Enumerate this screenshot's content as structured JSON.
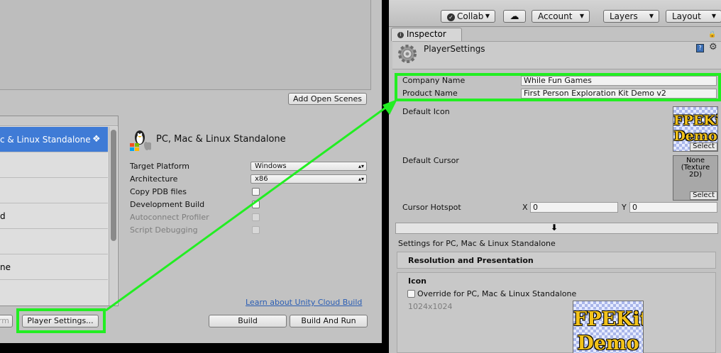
{
  "build_window": {
    "add_open_scenes": "Add Open Scenes",
    "platform_list": [
      "c & Linux Standalone",
      "",
      "",
      "d",
      "",
      "ne",
      ""
    ],
    "platform_title": "PC, Mac & Linux Standalone",
    "settings": {
      "target_platform_label": "Target Platform",
      "target_platform_value": "Windows",
      "architecture_label": "Architecture",
      "architecture_value": "x86",
      "copy_pdb_label": "Copy PDB files",
      "development_build_label": "Development Build",
      "autoconnect_label": "Autoconnect Profiler",
      "script_debugging_label": "Script Debugging"
    },
    "learn_link": "Learn about Unity Cloud Build",
    "switch_platform_partial": "rm",
    "player_settings_button": "Player Settings...",
    "build_button": "Build",
    "build_and_run_button": "Build And Run"
  },
  "toolbar": {
    "collab": "Collab",
    "account": "Account",
    "layers": "Layers",
    "layout": "Layout"
  },
  "inspector": {
    "tab_label": "Inspector",
    "object_title": "PlayerSettings",
    "company_name_label": "Company Name",
    "company_name_value": "While Fun Games",
    "product_name_label": "Product Name",
    "product_name_value": "First Person Exploration Kit Demo v2",
    "default_icon_label": "Default Icon",
    "icon_logo_line1": "FPEKit",
    "icon_logo_line2": "Demo",
    "select_label": "Select",
    "default_cursor_label": "Default Cursor",
    "cursor_none_text": "None\n(Texture\n2D)",
    "cursor_hotspot_label": "Cursor Hotspot",
    "hotspot_x_label": "X",
    "hotspot_x_value": "0",
    "hotspot_y_label": "Y",
    "hotspot_y_value": "0",
    "settings_for": "Settings for PC, Mac & Linux Standalone",
    "resolution_section": "Resolution and Presentation",
    "icon_section": "Icon",
    "override_label": "Override for PC, Mac & Linux Standalone",
    "icon_size": "1024x1024"
  },
  "colors": {
    "highlight_green": "#22ee22",
    "panel_gray": "#c2c2c2",
    "selection_blue": "#3f7bd6",
    "link_blue": "#2a5db3"
  }
}
